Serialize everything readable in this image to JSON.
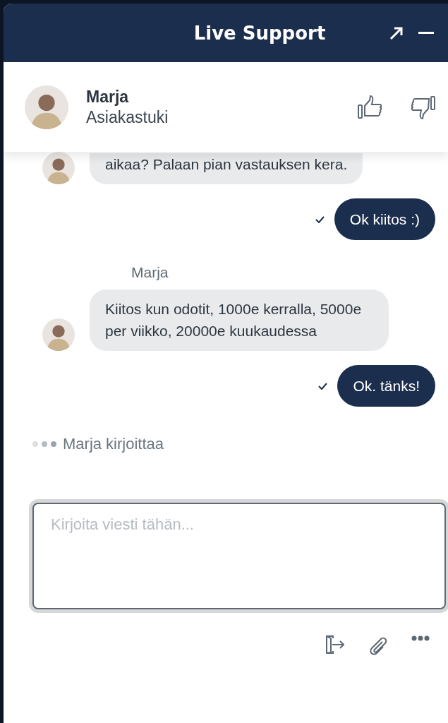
{
  "header": {
    "title": "Live Support"
  },
  "agent": {
    "name": "Marja",
    "role": "Asiakastuki"
  },
  "messages": [
    {
      "kind": "agent",
      "text": "aikaa? Palaan pian vastauksen kera.",
      "clipped": true
    },
    {
      "kind": "user",
      "text": "Ok kiitos :)",
      "delivered": true
    },
    {
      "kind": "agent",
      "sender": "Marja",
      "text": "Kiitos kun odotit, 1000e kerralla, 5000e per viikko, 20000e kuukaudessa",
      "clipped": false
    },
    {
      "kind": "user",
      "text": "Ok. tänks!",
      "delivered": true
    }
  ],
  "typing": {
    "text": "Marja kirjoittaa"
  },
  "composer": {
    "placeholder": "Kirjoita viesti tähän..."
  }
}
